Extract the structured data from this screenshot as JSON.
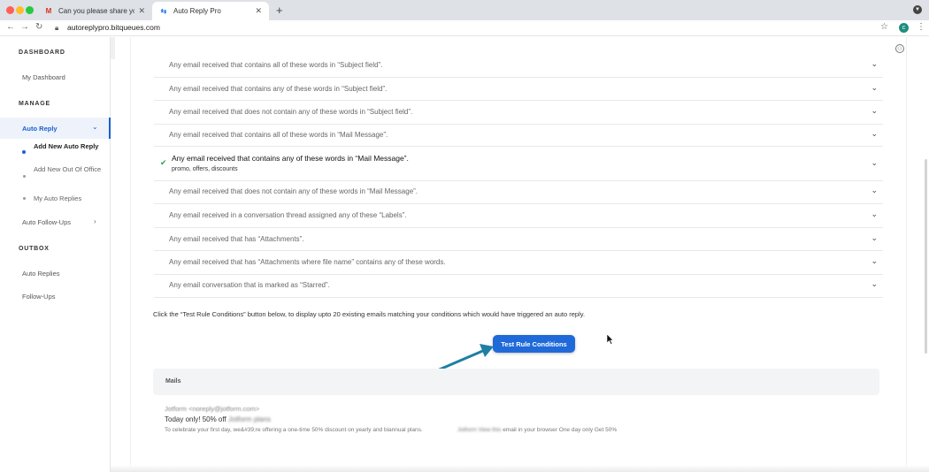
{
  "browser": {
    "tabs": [
      {
        "title": "Can you please share your me",
        "favicon": "gmail-icon"
      },
      {
        "title": "Auto Reply Pro",
        "favicon": "autoreply-icon"
      }
    ],
    "new_tab": "+",
    "url": "autoreplypro.bitqueues.com",
    "profile_initial": "c"
  },
  "sidebar": {
    "dashboard_heading": "DASHBOARD",
    "my_dashboard": "My Dashboard",
    "manage_heading": "MANAGE",
    "auto_reply": "Auto Reply",
    "sub_items": [
      "Add New Auto Reply",
      "Add New Out Of Office",
      "My Auto Replies"
    ],
    "auto_followups": "Auto Follow-Ups",
    "outbox_heading": "OUTBOX",
    "auto_replies": "Auto Replies",
    "followups": "Follow-Ups"
  },
  "rules": [
    {
      "label": "Any email received that contains all of these words in “Subject field”."
    },
    {
      "label": "Any email received that contains any of these words in “Subject field”."
    },
    {
      "label": "Any email received that does not contain any of these words in “Subject field”."
    },
    {
      "label": "Any email received that contains all of these words in “Mail Message”."
    },
    {
      "label": "Any email received that contains any of these words in “Mail Message”.",
      "checked": true,
      "value": "promo, offers, discounts"
    },
    {
      "label": "Any email received that does not contain any of these words in “Mail Message”."
    },
    {
      "label": "Any email received in a conversation thread assigned any of these “Labels”."
    },
    {
      "label": "Any email received that has “Attachments”."
    },
    {
      "label": "Any email received that has “Attachments where file name” contains any of these words."
    },
    {
      "label": "Any email conversation that is marked as “Starred”."
    }
  ],
  "hint": "Click the “Test Rule Conditions” button below, to display upto 20 existing emails matching your conditions which would have triggered an auto reply.",
  "test_button": "Test Rule Conditions",
  "mails": {
    "heading": "Mails",
    "from": "Jotform <noreply@jotform.com>",
    "subject_plain": "Today only! 50% off",
    "subject_blur": "Jotform plans",
    "preview_plain": "To celebrate your first day, we&#39;re offering a one-time 50% discount on yearly and biannual plans.",
    "preview2_blur": "Jotform View this",
    "preview2_plain": "email in your browser One day only Get 50%"
  },
  "colors": {
    "accent": "#1f6ad8",
    "arrow": "#1e7fa3",
    "check": "#2e9e4f"
  }
}
